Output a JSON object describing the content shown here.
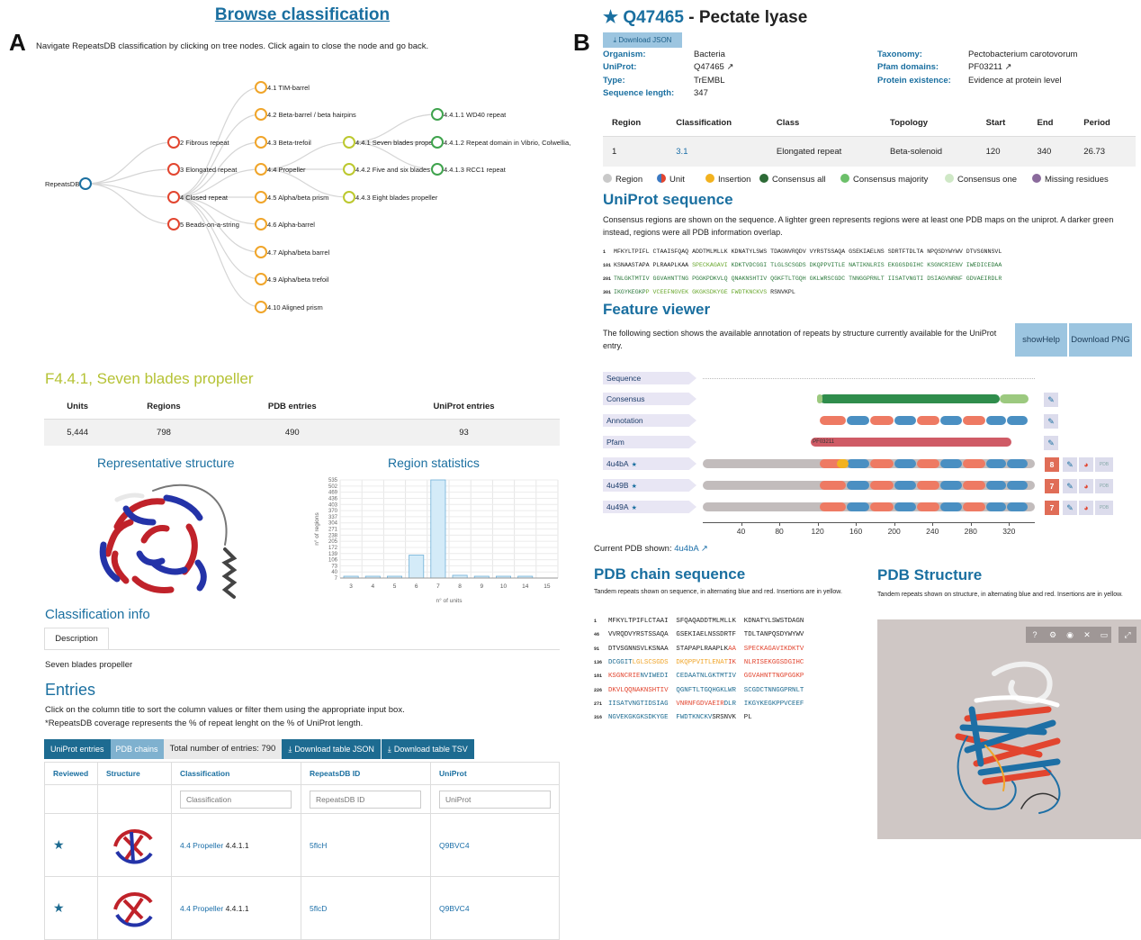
{
  "panel_a": {
    "letter": "A",
    "title": "Browse classification",
    "hint": "Navigate RepeatsDB classification by clicking on tree nodes. Click again to close the node and go back.",
    "tree": {
      "root": "RepeatsDB",
      "level1": [
        "2 Fibrous repeat",
        "3 Elongated repeat",
        "4 Closed repeat",
        "5 Beads-on-a-string"
      ],
      "level2": [
        "4.1 TIM-barrel",
        "4.2 Beta-barrel / beta hairpins",
        "4.3 Beta-trefoil",
        "4.4 Propeller",
        "4.5 Alpha/beta prism",
        "4.6 Alpha-barrel",
        "4.7 Alpha/beta barrel",
        "4.9 Alpha/beta trefoil",
        "4.10 Aligned prism"
      ],
      "level3": [
        "4.4.1 Seven blades propeller",
        "4.4.2 Five and six blades",
        "4.4.3 Eight blades propeller"
      ],
      "level4": [
        "4.4.1.1 WD40 repeat",
        "4.4.1.2 Repeat domain in Vibrio, Colwellia,",
        "4.4.1.3 RCC1 repeat"
      ],
      "colors": {
        "root": "#1a6fa0",
        "level1": "#e2452f",
        "level2": "#f0a52a",
        "level3": "#bcc82e",
        "level4": "#3fa34d",
        "links": "#d5d5d5"
      }
    },
    "family": {
      "title": "F4.4.1, Seven blades propeller",
      "headers": [
        "Units",
        "Regions",
        "PDB entries",
        "UniProt entries"
      ],
      "values": [
        "5,444",
        "798",
        "490",
        "93"
      ]
    },
    "representative_title": "Representative structure",
    "region_stats_title": "Region statistics",
    "chart_data": {
      "type": "bar",
      "title": "Region statistics",
      "xlabel": "n° of units",
      "ylabel": "n° of regions",
      "categories": [
        "3",
        "4",
        "5",
        "6",
        "7",
        "8",
        "9",
        "10",
        "14",
        "15"
      ],
      "values": [
        4,
        8,
        6,
        125,
        535,
        15,
        6,
        2,
        2,
        0
      ],
      "yticks": [
        "535",
        "502",
        "469",
        "436",
        "403",
        "370",
        "337",
        "304",
        "271",
        "238",
        "205",
        "172",
        "139",
        "106",
        "73",
        "40",
        "7"
      ],
      "ylim": [
        0,
        535
      ],
      "grid": true
    },
    "class_info_title": "Classification info",
    "description_tab": "Description",
    "description_text": "Seven blades propeller",
    "entries": {
      "title": "Entries",
      "hint1": "Click on the column title to sort the column values or filter them using the appropriate input box.",
      "hint2": "*RepeatsDB coverage represents the % of repeat lenght on the % of UniProt length.",
      "btn_uniprot": "UniProt entries",
      "btn_pdb": "PDB chains",
      "total": "Total number of entries: 790",
      "btn_json": "Download table JSON",
      "btn_tsv": "Download table TSV",
      "columns": [
        "Reviewed",
        "Structure",
        "Classification",
        "RepeatsDB ID",
        "UniProt"
      ],
      "placeholders": {
        "classification": "Classification",
        "repeatsdb": "RepeatsDB ID",
        "uniprot": "UniProt"
      },
      "rows": [
        {
          "class_link": "4.4 Propeller",
          "class_code": "4.4.1.1",
          "repeatsdb": "5flcH",
          "uniprot": "Q9BVC4"
        },
        {
          "class_link": "4.4 Propeller",
          "class_code": "4.4.1.1",
          "repeatsdb": "5flcD",
          "uniprot": "Q9BVC4"
        }
      ]
    }
  },
  "panel_b": {
    "letter": "B",
    "accession": "Q47465",
    "title_rest": " - Pectate lyase",
    "download_json": "Download JSON",
    "info_left": [
      {
        "key": "Organism:",
        "value": "Bacteria",
        "link": false
      },
      {
        "key": "UniProt:",
        "value": "Q47465",
        "link": true
      },
      {
        "key": "Type:",
        "value": "TrEMBL",
        "link": false
      },
      {
        "key": "Sequence length:",
        "value": "347",
        "link": false
      }
    ],
    "info_right": [
      {
        "key": "Taxonomy:",
        "value": "Pectobacterium carotovorum",
        "link": false
      },
      {
        "key": "Pfam domains:",
        "value": "PF03211",
        "link": true
      },
      {
        "key": "Protein existence:",
        "value": "Evidence at protein level",
        "link": false
      }
    ],
    "region_table": {
      "headers": [
        "Region",
        "Classification",
        "Class",
        "Topology",
        "Start",
        "End",
        "Period"
      ],
      "row": [
        "1",
        "3.1",
        "Elongated repeat",
        "Beta-solenoid",
        "120",
        "340",
        "26.73"
      ]
    },
    "legend": [
      {
        "label": "Region",
        "color": "#c9c9c9"
      },
      {
        "label": "Unit",
        "color": "#3b79c2"
      },
      {
        "label": "Insertion",
        "color": "#f2b21f"
      },
      {
        "label": "Consensus all",
        "color": "#2d6a36"
      },
      {
        "label": "Consensus majority",
        "color": "#6cc06a"
      },
      {
        "label": "Consensus one",
        "color": "#cfe8c6"
      },
      {
        "label": "Missing residues",
        "color": "#8a6a9c"
      }
    ],
    "uniprot_seq_title": "UniProt sequence",
    "uniprot_seq_text": "Consensus regions are shown on the sequence. A lighter green represents regions were at least one PDB maps on the uniprot. A darker green instead, regions were all PDB information overlap.",
    "uniprot_seq_rows": [
      {
        "idx": "1",
        "black": "MFKYLTPIFL CTAAISFQAQ ADDTMLMLLK KDNATYLSWS TDAGNVRQDV VYRSTSSAQA GSEKIAELNS SDRTFTDLTA NPQSDYWYWV DTVSGNNSVL",
        "light": "",
        "dark": ""
      },
      {
        "idx": "101",
        "black": "KSNAASTAPA PLRAAPLKAA ",
        "light": "SPECKAGAVI ",
        "dark": "KDKTVDCGGI TLGLSCSGDS DKQPPVITLE NATIKNLRIS EKGGSDGIHC KSGNCRIENV IWEDICEDAA"
      },
      {
        "idx": "201",
        "black": "",
        "light": "",
        "dark": "TNLGKTMTIV GGVAHNTTNG PGGKPDKVLQ QNAKNSHTIV QGKFTLTGQH GKLWRSCGDC TNNGGPRNLT IISATVNGTI DSIAGVNRNF GDVAEIRDLR"
      },
      {
        "idx": "301",
        "black": "",
        "light": "",
        "dark": "IKGYKEGKP",
        "tail_light": "P VCEEFNGVEK GKGKSDKYGE FWDTKNCKVS ",
        "tail_black": "RSNVKPL"
      }
    ],
    "feature_viewer_title": "Feature viewer",
    "feature_viewer_text": "The following section shows the available annotation of repeats by structure currently available for the UniProt entry.",
    "btn_show_help": "showHelp",
    "btn_download_png": "Download PNG",
    "tracks": [
      "Sequence",
      "Consensus",
      "Annotation",
      "Pfam",
      "4u4bA",
      "4u49B",
      "4u49A"
    ],
    "pfam_label": "PF03211",
    "pdb_counts": [
      "8",
      "7",
      "7"
    ],
    "axis_ticks": [
      "40",
      "80",
      "120",
      "160",
      "200",
      "240",
      "280",
      "320"
    ],
    "current_pdb_label": "Current PDB shown:",
    "current_pdb": "4u4bA",
    "pdb_chain_title": "PDB chain sequence",
    "pdb_chain_text": "Tandem repeats shown on sequence, in alternating blue and red. Insertions are in yellow.",
    "pdb_structure_title": "PDB Structure",
    "pdb_structure_text": "Tandem repeats shown on structure, in alternating blue and red. Insertions are in yellow.",
    "pdb_rows": [
      {
        "idx": "1",
        "segs": [
          [
            "MFKYLTPIFLCTAAI  SFQAQADDTMLMLLK  KDNATYLSWSTDAGN",
            "#222"
          ]
        ]
      },
      {
        "idx": "46",
        "segs": [
          [
            "VVRQDVYRSTSSAQA  GSEKIAELNSSDRTF  TDLTANPQSDYWYWV",
            "#222"
          ]
        ]
      },
      {
        "idx": "91",
        "segs": [
          [
            "DTVSGNNSVLKSNAA  STAPAPLRAAPLK",
            "#222"
          ],
          [
            "AA  SPECKAGAVIKDKTV",
            "#e2452f"
          ]
        ]
      },
      {
        "idx": "136",
        "segs": [
          [
            "DCGGIT",
            "#1d6b91"
          ],
          [
            "LGLSCSGDS  DKQPPVITLENAT",
            "#f0a52a"
          ],
          [
            "IK  NLRISEKGGSDGIHC",
            "#e2452f"
          ]
        ]
      },
      {
        "idx": "181",
        "segs": [
          [
            "KSGNCRIE",
            "#e2452f"
          ],
          [
            "NVIWEDI  CEDAATNLGKTMTIV",
            "#1d6b91"
          ],
          [
            "  GGVAHNTTNGPGGKP",
            "#e2452f"
          ]
        ]
      },
      {
        "idx": "226",
        "segs": [
          [
            "DKVLQQNAKNSHTIV",
            "#e2452f"
          ],
          [
            "  QGNFTLTGQHGKLWR  SCGDCTNNGGPRNLT",
            "#1d6b91"
          ]
        ]
      },
      {
        "idx": "271",
        "segs": [
          [
            "IISATVNGTIDSIAG",
            "#1d6b91"
          ],
          [
            "  VNRNFGDVAEIR",
            "#e2452f"
          ],
          [
            "DLR  IKGYKEGKPPVCEEF",
            "#1d6b91"
          ]
        ]
      },
      {
        "idx": "316",
        "segs": [
          [
            "NGVEKGKGKSDKYGE  FWDTKNCKV",
            "#1d6b91"
          ],
          [
            "SRSNVK  PL",
            "#222"
          ]
        ]
      }
    ]
  }
}
